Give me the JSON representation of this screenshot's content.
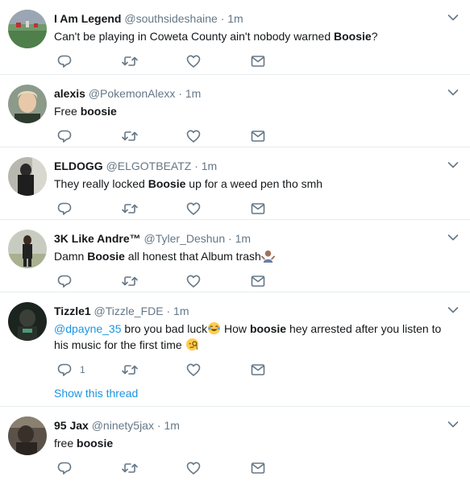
{
  "tweets": [
    {
      "name": "I Am Legend",
      "handle": "@southsideshaine",
      "sep": "·",
      "time": "1m",
      "pre": "Can't be playing in Coweta County ain't nobody warned ",
      "bold": "Boosie",
      "post": "?"
    },
    {
      "name": "alexis",
      "handle": "@PokemonAlexx",
      "sep": "·",
      "time": "1m",
      "pre": "Free ",
      "bold": "boosie",
      "post": ""
    },
    {
      "name": "ELDOGG",
      "handle": "@ELGOTBEATZ",
      "sep": "·",
      "time": "1m",
      "pre": "They really locked ",
      "bold": "Boosie",
      "post": " up for a weed pen tho smh"
    },
    {
      "name": "3K Like Andre™",
      "handle": "@Tyler_Deshun",
      "sep": "·",
      "time": "1m",
      "pre": "Damn ",
      "bold": "Boosie",
      "post": " all honest that Album trash",
      "emoji": "person-shrugging"
    },
    {
      "name": "Tizzle1",
      "handle": "@Tizzle_FDE",
      "sep": "·",
      "time": "1m",
      "mention": "@dpayne_35",
      "pre": " bro you bad luck",
      "emoji1": "tears-of-joy",
      "mid": " How ",
      "bold": "boosie",
      "post": " hey arrested after you listen to his music for the first time",
      "emoji2": "face-with-monocle",
      "reply_count": "1",
      "show_thread": "Show this thread"
    },
    {
      "name": "95 Jax",
      "handle": "@ninety5jax",
      "sep": "·",
      "time": "1m",
      "pre": "free ",
      "bold": "boosie",
      "post": ""
    }
  ],
  "colors": {
    "name": "#14171a",
    "meta": "#657786",
    "link": "#1b95e0",
    "divider": "#e6ecf0"
  },
  "icons": [
    "reply-icon",
    "retweet-icon",
    "like-icon",
    "direct-message-icon",
    "caret-down-icon"
  ]
}
